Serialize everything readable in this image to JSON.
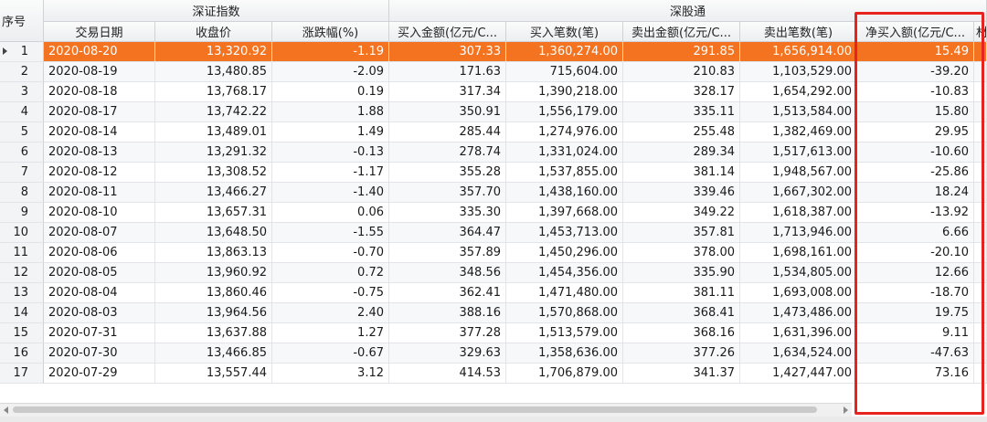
{
  "header": {
    "seq": "序号",
    "group_szzs": "深证指数",
    "group_sgt": "深股通",
    "cols": {
      "date": "交易日期",
      "close": "收盘价",
      "change": "涨跌幅(%)",
      "buy_amount": "买入金额(亿元/C...",
      "buy_count": "买入笔数(笔)",
      "sell_amount": "卖出金额(亿元/C...",
      "sell_count": "卖出笔数(笔)",
      "net_buy": "净买入额(亿元/C...",
      "cut_col": "材"
    }
  },
  "selected_row": 1,
  "rows": [
    {
      "idx": "1",
      "date": "2020-08-20",
      "close": "13,320.92",
      "change": "-1.19",
      "buy_amount": "307.33",
      "buy_count": "1,360,274.00",
      "sell_amount": "291.85",
      "sell_count": "1,656,914.00",
      "net_buy": "15.49"
    },
    {
      "idx": "2",
      "date": "2020-08-19",
      "close": "13,480.85",
      "change": "-2.09",
      "buy_amount": "171.63",
      "buy_count": "715,604.00",
      "sell_amount": "210.83",
      "sell_count": "1,103,529.00",
      "net_buy": "-39.20"
    },
    {
      "idx": "3",
      "date": "2020-08-18",
      "close": "13,768.17",
      "change": "0.19",
      "buy_amount": "317.34",
      "buy_count": "1,390,218.00",
      "sell_amount": "328.17",
      "sell_count": "1,654,292.00",
      "net_buy": "-10.83"
    },
    {
      "idx": "4",
      "date": "2020-08-17",
      "close": "13,742.22",
      "change": "1.88",
      "buy_amount": "350.91",
      "buy_count": "1,556,179.00",
      "sell_amount": "335.11",
      "sell_count": "1,513,584.00",
      "net_buy": "15.80"
    },
    {
      "idx": "5",
      "date": "2020-08-14",
      "close": "13,489.01",
      "change": "1.49",
      "buy_amount": "285.44",
      "buy_count": "1,274,976.00",
      "sell_amount": "255.48",
      "sell_count": "1,382,469.00",
      "net_buy": "29.95"
    },
    {
      "idx": "6",
      "date": "2020-08-13",
      "close": "13,291.32",
      "change": "-0.13",
      "buy_amount": "278.74",
      "buy_count": "1,331,024.00",
      "sell_amount": "289.34",
      "sell_count": "1,517,613.00",
      "net_buy": "-10.60"
    },
    {
      "idx": "7",
      "date": "2020-08-12",
      "close": "13,308.52",
      "change": "-1.17",
      "buy_amount": "355.28",
      "buy_count": "1,537,855.00",
      "sell_amount": "381.14",
      "sell_count": "1,948,567.00",
      "net_buy": "-25.86"
    },
    {
      "idx": "8",
      "date": "2020-08-11",
      "close": "13,466.27",
      "change": "-1.40",
      "buy_amount": "357.70",
      "buy_count": "1,438,160.00",
      "sell_amount": "339.46",
      "sell_count": "1,667,302.00",
      "net_buy": "18.24"
    },
    {
      "idx": "9",
      "date": "2020-08-10",
      "close": "13,657.31",
      "change": "0.06",
      "buy_amount": "335.30",
      "buy_count": "1,397,668.00",
      "sell_amount": "349.22",
      "sell_count": "1,618,387.00",
      "net_buy": "-13.92"
    },
    {
      "idx": "10",
      "date": "2020-08-07",
      "close": "13,648.50",
      "change": "-1.55",
      "buy_amount": "364.47",
      "buy_count": "1,453,713.00",
      "sell_amount": "357.81",
      "sell_count": "1,713,946.00",
      "net_buy": "6.66"
    },
    {
      "idx": "11",
      "date": "2020-08-06",
      "close": "13,863.13",
      "change": "-0.70",
      "buy_amount": "357.89",
      "buy_count": "1,450,296.00",
      "sell_amount": "378.00",
      "sell_count": "1,698,161.00",
      "net_buy": "-20.10"
    },
    {
      "idx": "12",
      "date": "2020-08-05",
      "close": "13,960.92",
      "change": "0.72",
      "buy_amount": "348.56",
      "buy_count": "1,454,356.00",
      "sell_amount": "335.90",
      "sell_count": "1,534,805.00",
      "net_buy": "12.66"
    },
    {
      "idx": "13",
      "date": "2020-08-04",
      "close": "13,860.46",
      "change": "-0.75",
      "buy_amount": "362.41",
      "buy_count": "1,471,480.00",
      "sell_amount": "381.11",
      "sell_count": "1,693,008.00",
      "net_buy": "-18.70"
    },
    {
      "idx": "14",
      "date": "2020-08-03",
      "close": "13,964.56",
      "change": "2.40",
      "buy_amount": "388.16",
      "buy_count": "1,570,868.00",
      "sell_amount": "368.41",
      "sell_count": "1,473,486.00",
      "net_buy": "19.75"
    },
    {
      "idx": "15",
      "date": "2020-07-31",
      "close": "13,637.88",
      "change": "1.27",
      "buy_amount": "377.28",
      "buy_count": "1,513,579.00",
      "sell_amount": "368.16",
      "sell_count": "1,631,396.00",
      "net_buy": "9.11"
    },
    {
      "idx": "16",
      "date": "2020-07-30",
      "close": "13,466.85",
      "change": "-0.67",
      "buy_amount": "329.63",
      "buy_count": "1,358,636.00",
      "sell_amount": "377.26",
      "sell_count": "1,634,524.00",
      "net_buy": "-47.63"
    },
    {
      "idx": "17",
      "date": "2020-07-29",
      "close": "13,557.44",
      "change": "3.12",
      "buy_amount": "414.53",
      "buy_count": "1,706,879.00",
      "sell_amount": "341.37",
      "sell_count": "1,427,447.00",
      "net_buy": "73.16"
    }
  ]
}
